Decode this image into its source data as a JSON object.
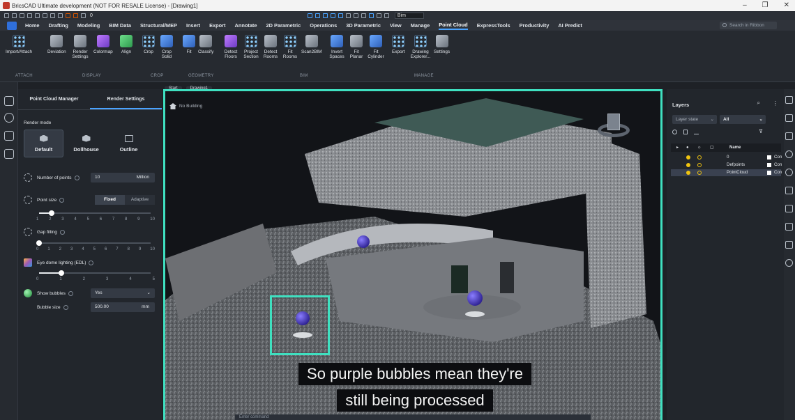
{
  "window": {
    "title": "BricsCAD Ultimate development (NOT FOR RESALE License) - [Drawing1]",
    "minimize": "–",
    "restore": "❐",
    "close": "✕"
  },
  "quick_access": {
    "layer_value": "0",
    "workspace": "Bim"
  },
  "menu": {
    "items": [
      "Home",
      "Drafting",
      "Modeling",
      "BIM Data",
      "Structural/MEP",
      "Insert",
      "Export",
      "Annotate",
      "2D Parametric",
      "Operations",
      "3D Parametric",
      "View",
      "Manage",
      "Point Cloud",
      "ExpressTools",
      "Productivity",
      "AI Predict"
    ],
    "active": "Point Cloud",
    "search_placeholder": "Search in Ribbon"
  },
  "ribbon": {
    "buttons": [
      "Import/Attach",
      "Deviation",
      "Render Settings",
      "Colormap",
      "Align",
      "Crop",
      "Crop Solid",
      "Fit",
      "Classify",
      "Detect Floors",
      "Project Section",
      "Detect Rooms",
      "Fit Rooms",
      "Scan2BIM",
      "Invert Spaces",
      "Fit Planar",
      "Fit Cylinder",
      "Export",
      "Drawing Explorer...",
      "Settings"
    ],
    "groups": [
      "ATTACH",
      "DISPLAY",
      "CROP",
      "GEOMETRY",
      "BIM",
      "MANAGE"
    ]
  },
  "left_panel": {
    "tabs": [
      "Point Cloud Manager",
      "Render Settings"
    ],
    "render_mode_label": "Render mode",
    "modes": [
      "Default",
      "Dollhouse",
      "Outline"
    ],
    "selected_mode": "Default",
    "number_of_points": {
      "label": "Number of points",
      "value": "10",
      "unit": "Million"
    },
    "point_size": {
      "label": "Point size",
      "options": [
        "Fixed",
        "Adaptive"
      ],
      "selected": "Fixed",
      "ticks": [
        "1",
        "2",
        "3",
        "4",
        "5",
        "6",
        "7",
        "8",
        "9",
        "10"
      ],
      "value": 2
    },
    "gap_filling": {
      "label": "Gap filling",
      "ticks": [
        "0",
        "1",
        "2",
        "3",
        "4",
        "5",
        "6",
        "7",
        "8",
        "9",
        "10"
      ],
      "value": 0
    },
    "edl": {
      "label": "Eye dome lighting (EDL)",
      "ticks": [
        "0",
        "1",
        "2",
        "3",
        "4",
        "5"
      ],
      "value": 1
    },
    "show_bubbles": {
      "label": "Show bubbles",
      "value": "Yes"
    },
    "bubble_size": {
      "label": "Bubble size",
      "value": "500.00",
      "unit": "mm"
    }
  },
  "viewport": {
    "tabs": [
      "Start",
      "Drawing1"
    ],
    "building": "No Building",
    "command_placeholder": "Enter command",
    "caption_line1": "So purple bubbles mean they're",
    "caption_line2": "still being processed"
  },
  "layers_panel": {
    "title": "Layers",
    "layer_state": "Layer state",
    "filter": "All",
    "columns": [
      "Name"
    ],
    "rows": [
      {
        "name": "0",
        "color": "Con"
      },
      {
        "name": "Defpoints",
        "color": "Con"
      },
      {
        "name": "PointCloud",
        "color": "Con"
      }
    ]
  },
  "colors": {
    "accent": "#3fe0c0",
    "tab_active": "#4aa3ff",
    "bubble": "#4b3cc7"
  }
}
